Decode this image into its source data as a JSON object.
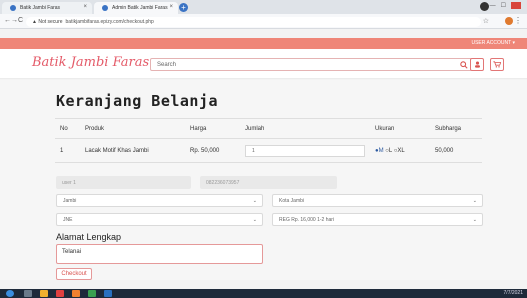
{
  "browser": {
    "tabs": [
      {
        "label": "Batik Jambi Faras",
        "close": "×"
      },
      {
        "label": "Admin Batik Jambi Faras",
        "close": "×"
      }
    ],
    "new_tab": "+",
    "nav_back": "←",
    "nav_forward": "→",
    "nav_reload": "C",
    "security": "▲ Not secure",
    "url": "batikjambifaras.epizy.com/checkout.php",
    "star": "☆",
    "menu": "⋮",
    "min": "—",
    "max": "☐"
  },
  "site": {
    "account_label": "USER ACCOUNT ▾",
    "logo": "Batik Jambi Faras",
    "search_placeholder": "Search",
    "search_icon": "search-icon",
    "user_icon": "user-icon",
    "cart_icon": "cart-icon",
    "colors": {
      "topbar": "#ef8678",
      "accent": "#d9534f"
    }
  },
  "cart": {
    "title": "Keranjang Belanja",
    "headers": [
      "No",
      "Produk",
      "Harga",
      "Jumlah",
      "Ukuran",
      "Subharga"
    ],
    "rows": [
      {
        "no": "1",
        "produk": "Lacak Motif Khas Jambi",
        "harga": "Rp. 50,000",
        "jumlah": "1",
        "ukuran": {
          "options": [
            "M",
            "L",
            "XL"
          ],
          "selected": "M"
        },
        "subharga": "50,000"
      }
    ]
  },
  "form": {
    "name": "user 1",
    "phone": "082236073957",
    "province": "Jambi",
    "city": "Kota Jambi",
    "courier": "JNE",
    "service": "REG Rp. 16,000 1-2 hari",
    "address_label": "Alamat Lengkap",
    "address_value": "Telanai",
    "checkout_label": "Checkout"
  },
  "taskbar": {
    "clock": "7/7/2021"
  }
}
